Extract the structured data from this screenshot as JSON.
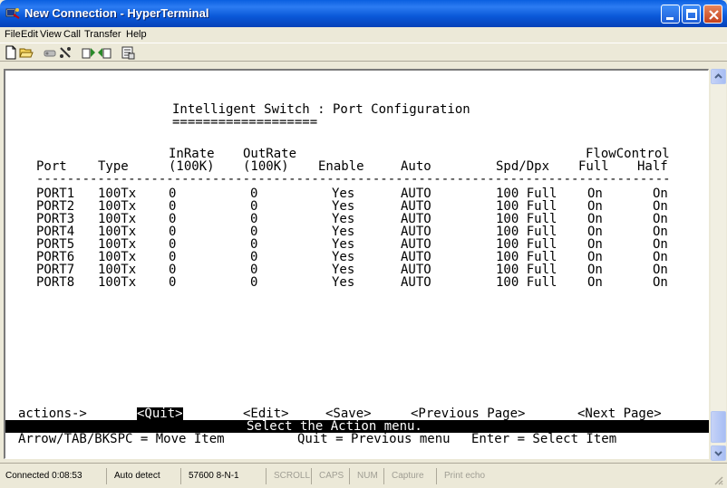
{
  "window": {
    "title": "New Connection - HyperTerminal",
    "icon": "hyperterminal-icon"
  },
  "menu": [
    "File",
    "Edit",
    "View",
    "Call",
    "Transfer",
    "Help"
  ],
  "toolbar": {
    "icons": [
      "new-icon",
      "open-icon",
      "disconnect-icon",
      "dial-icon",
      "send-icon",
      "receive-icon",
      "properties-icon"
    ]
  },
  "terminal": {
    "heading": "Intelligent Switch : Port Configuration",
    "heading_rule": "===================",
    "columns": {
      "port": "Port",
      "type": "Type",
      "inrate_1": "InRate",
      "inrate_2": "(100K)",
      "outrate_1": "OutRate",
      "outrate_2": "(100K)",
      "enable": "Enable",
      "auto": "Auto",
      "spd": "Spd/Dpx",
      "flow": "FlowControl",
      "full": "Full",
      "half": "Half"
    },
    "separator": "-----------------------------------------------------------------------------------------",
    "rows": [
      {
        "port": "PORT1",
        "type": "100Tx",
        "inrate": "0",
        "outrate": "0",
        "enable": "Yes",
        "auto": "AUTO",
        "spd": "100 Full",
        "full": "On",
        "half": "On"
      },
      {
        "port": "PORT2",
        "type": "100Tx",
        "inrate": "0",
        "outrate": "0",
        "enable": "Yes",
        "auto": "AUTO",
        "spd": "100 Full",
        "full": "On",
        "half": "On"
      },
      {
        "port": "PORT3",
        "type": "100Tx",
        "inrate": "0",
        "outrate": "0",
        "enable": "Yes",
        "auto": "AUTO",
        "spd": "100 Full",
        "full": "On",
        "half": "On"
      },
      {
        "port": "PORT4",
        "type": "100Tx",
        "inrate": "0",
        "outrate": "0",
        "enable": "Yes",
        "auto": "AUTO",
        "spd": "100 Full",
        "full": "On",
        "half": "On"
      },
      {
        "port": "PORT5",
        "type": "100Tx",
        "inrate": "0",
        "outrate": "0",
        "enable": "Yes",
        "auto": "AUTO",
        "spd": "100 Full",
        "full": "On",
        "half": "On"
      },
      {
        "port": "PORT6",
        "type": "100Tx",
        "inrate": "0",
        "outrate": "0",
        "enable": "Yes",
        "auto": "AUTO",
        "spd": "100 Full",
        "full": "On",
        "half": "On"
      },
      {
        "port": "PORT7",
        "type": "100Tx",
        "inrate": "0",
        "outrate": "0",
        "enable": "Yes",
        "auto": "AUTO",
        "spd": "100 Full",
        "full": "On",
        "half": "On"
      },
      {
        "port": "PORT8",
        "type": "100Tx",
        "inrate": "0",
        "outrate": "0",
        "enable": "Yes",
        "auto": "AUTO",
        "spd": "100 Full",
        "full": "On",
        "half": "On"
      }
    ],
    "actions": {
      "label": "actions->",
      "quit": "<Quit>",
      "cursor": "_",
      "edit": "<Edit>",
      "save": "<Save>",
      "prev": "<Previous Page>",
      "next": "<Next Page>"
    },
    "status_message": "Select the Action menu.",
    "help_line": {
      "move": "Arrow/TAB/BKSPC = Move Item",
      "quit": "Quit = Previous menu",
      "select": "Enter = Select Item"
    }
  },
  "statusbar": {
    "connected": "Connected 0:08:53",
    "detect": "Auto detect",
    "settings": "57600 8-N-1",
    "scroll": "SCROLL",
    "caps": "CAPS",
    "num": "NUM",
    "capture": "Capture",
    "echo": "Print echo"
  }
}
